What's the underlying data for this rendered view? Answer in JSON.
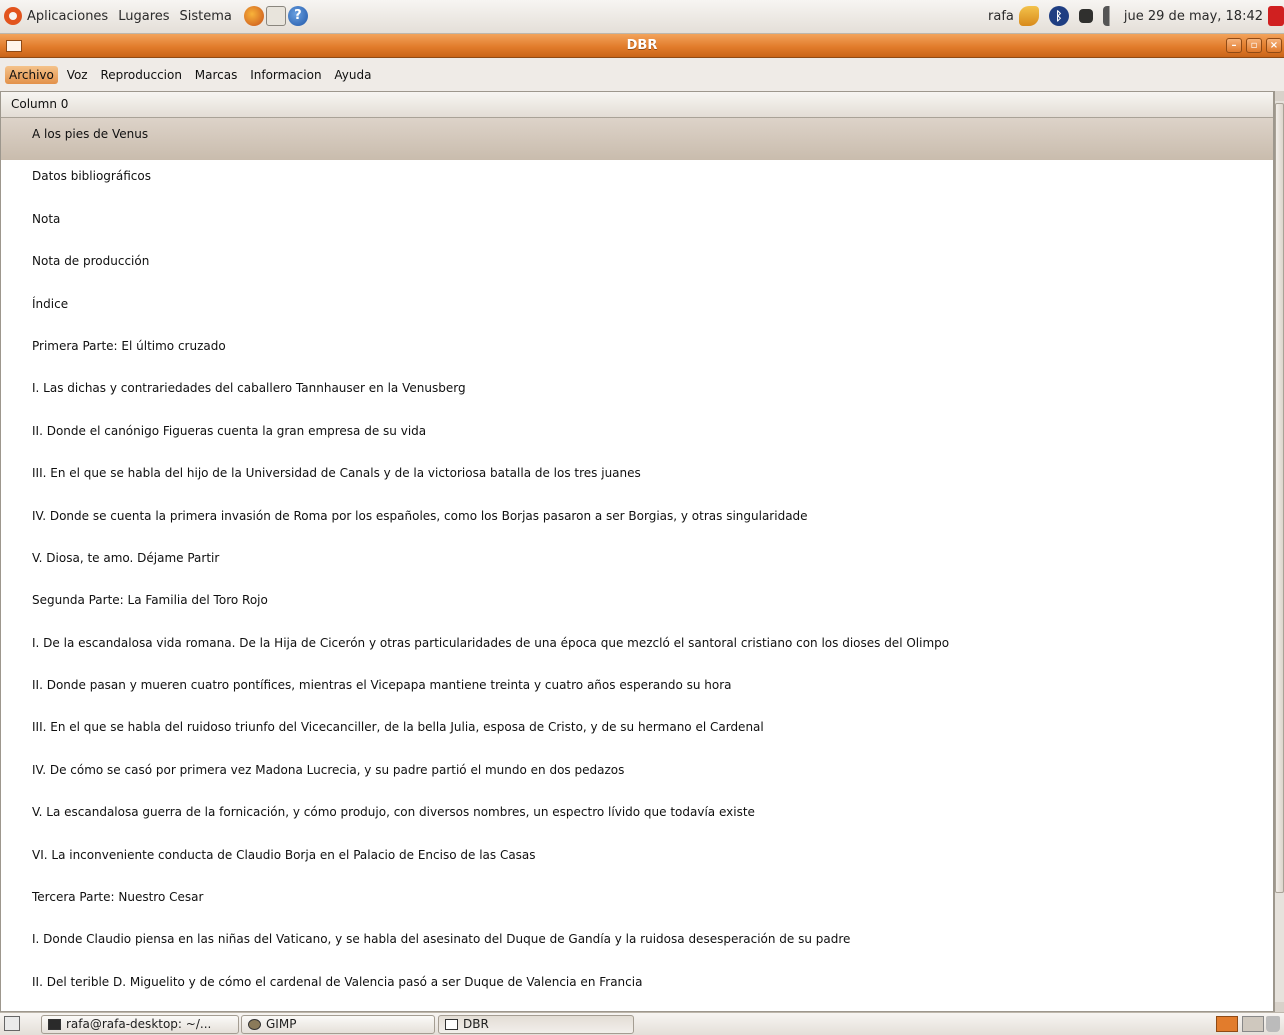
{
  "top_panel": {
    "menus": [
      "Aplicaciones",
      "Lugares",
      "Sistema"
    ],
    "user": "rafa",
    "clock": "jue 29 de may, 18:42"
  },
  "window": {
    "title": "DBR"
  },
  "menubar": {
    "items": [
      "Archivo",
      "Voz",
      "Reproduccion",
      "Marcas",
      "Informacion",
      "Ayuda"
    ]
  },
  "listview": {
    "column_header": "Column 0",
    "selected_index": 0,
    "rows": [
      "A los pies de Venus",
      "Datos bibliográficos",
      "Nota",
      "Nota de producción",
      "Índice",
      "Primera Parte: El último cruzado",
      "I. Las dichas y contrariedades del caballero Tannhauser en la Venusberg",
      "II. Donde el canónigo Figueras cuenta la gran empresa de su vida",
      "III. En el que se habla del hijo de la Universidad de Canals y de la victoriosa batalla de los tres juanes",
      "IV. Donde se cuenta la primera invasión de Roma por los españoles, como los Borjas pasaron a ser Borgias, y otras singularidade",
      "V. Diosa, te amo. Déjame Partir",
      "Segunda Parte: La Familia del Toro Rojo",
      "I. De la escandalosa vida romana. De la Hija de Cicerón y otras particularidades de una época que mezcló el santoral cristiano con los dioses del Olimpo",
      "II. Donde pasan y mueren cuatro pontífices, mientras el Vicepapa mantiene treinta y cuatro años esperando su hora",
      "III. En el que se habla del ruidoso triunfo del Vicecanciller, de la bella Julia, esposa de Cristo, y de su hermano el Cardenal",
      "IV. De cómo se casó por primera vez Madona Lucrecia, y su padre partió el mundo en dos pedazos",
      "V. La escandalosa guerra de la fornicación, y cómo produjo, con diversos nombres, un espectro lívido que todavía existe",
      "VI. La inconveniente conducta de Claudio Borja en el Palacio de Enciso de las Casas",
      "Tercera Parte: Nuestro Cesar",
      "I. Donde Claudio piensa en las niñas del Vaticano, y se habla del asesinato del Duque de Gandía y la ruidosa desesperación de su padre",
      "II. Del terible D. Miguelito y de cómo el cardenal de Valencia pasó a ser Duque de Valencia en Francia"
    ]
  },
  "taskbar": {
    "tasks": [
      "rafa@rafa-desktop: ~/...",
      "GIMP",
      "DBR"
    ]
  },
  "colors": {
    "accent": "#e27c2c",
    "selection": "#d2c6b9",
    "panel_bg": "#efebe7"
  }
}
